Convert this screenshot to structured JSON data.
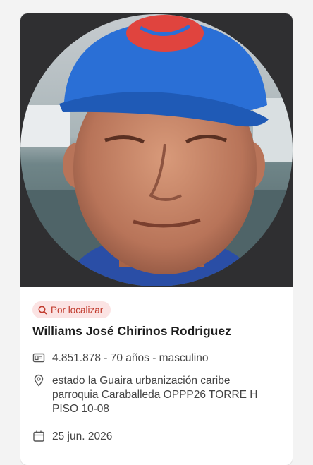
{
  "person": {
    "status_badge": "Por localizar",
    "name": "Williams José Chirinos Rodriguez",
    "id_info": "4.851.878 - 70 años - masculino",
    "address": "estado la Guaira urbanización caribe parroquia Caraballeda OPPP26 TORRE H PISO 10-08",
    "date": "25 jun. 2026"
  },
  "icons": {
    "badge": "search-icon",
    "id": "id-card-icon",
    "address": "location-pin-icon",
    "date": "calendar-icon"
  },
  "colors": {
    "badge_bg": "#fbe3e3",
    "badge_text": "#c0392b",
    "photo_bg": "#2f2f31",
    "cap_blue": "#2a6fd6"
  }
}
